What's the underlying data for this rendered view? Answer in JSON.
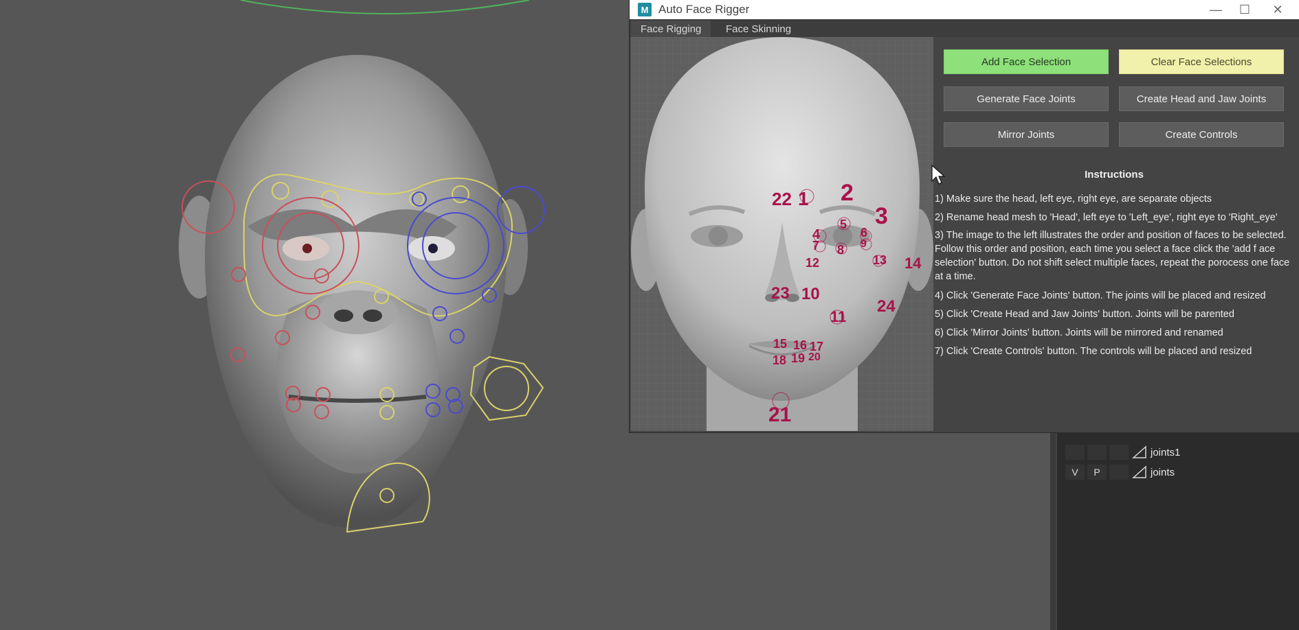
{
  "window": {
    "title": "Auto Face Rigger",
    "app_icon_letter": "M",
    "minimize_glyph": "—",
    "maximize_glyph": "☐",
    "close_glyph": "✕"
  },
  "tabs": [
    {
      "label": "Face Rigging",
      "active": true
    },
    {
      "label": "Face Skinning",
      "active": false
    }
  ],
  "buttons": {
    "add_face_selection": "Add Face Selection",
    "clear_face_selections": "Clear Face Selections",
    "generate_face_joints": "Generate Face Joints",
    "create_head_and_jaw_joints": "Create Head and Jaw Joints",
    "mirror_joints": "Mirror Joints",
    "create_controls": "Create Controls"
  },
  "instructions": {
    "title": "Instructions",
    "steps": [
      "1) Make sure the head, left eye, right eye, are separate objects",
      "2) Rename head mesh to 'Head', left eye to 'Left_eye', right eye to 'Right_eye'",
      "3) The image to the left illustrates the order and position of faces to be selected. Follow this order and position, each time you select a face click the 'add f ace selection' button. Do not shift select multiple faces, repeat the porocess one face at a time.",
      "4) Click 'Generate Face Joints' button. The joints will be placed and resized",
      "5) Click 'Create Head and Jaw Joints' button. Joints will be parented",
      "6) Click 'Mirror Joints' button. Joints will be mirrored and renamed",
      "7) Click 'Create Controls' button. The controls will be placed and resized"
    ]
  },
  "face_markers": [
    "1",
    "2",
    "3",
    "4",
    "5",
    "6",
    "7",
    "8",
    "9",
    "10",
    "11",
    "12",
    "13",
    "14",
    "15",
    "16",
    "17",
    "18",
    "19",
    "20",
    "21",
    "22",
    "23",
    "24"
  ],
  "outliner": {
    "rows": [
      {
        "v": "",
        "p": "",
        "name": "joints1"
      },
      {
        "v": "V",
        "p": "P",
        "name": "joints"
      }
    ]
  },
  "colors": {
    "add_button": "#8ee07a",
    "clear_button": "#f2f1ab",
    "marker": "#a8124a"
  }
}
